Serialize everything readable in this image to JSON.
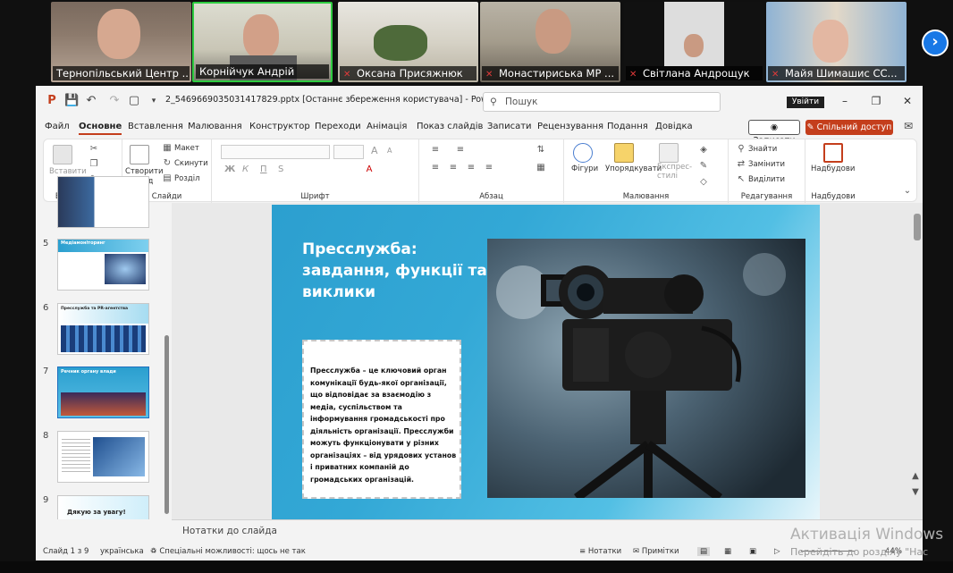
{
  "meeting": {
    "participants": [
      {
        "name": "Тернопільський Центр ...",
        "muted": false,
        "active": false
      },
      {
        "name": "Корнійчук Андрій",
        "muted": false,
        "active": true
      },
      {
        "name": "Оксана Присяжнюк",
        "muted": true,
        "active": false
      },
      {
        "name": "Монастириська МР ...",
        "muted": true,
        "active": false
      },
      {
        "name": "Світлана Андрощук",
        "muted": true,
        "active": false
      },
      {
        "name": "Майя Шимашис   СС...",
        "muted": true,
        "active": false
      }
    ],
    "next_icon": "chevron-right-icon"
  },
  "titlebar": {
    "doc_title": "2_5469669035031417829.pptx [Останнє збереження користувача]  -  PowerPoint Prev...",
    "search_placeholder": "Пошук",
    "signin_label": "Увійти"
  },
  "menu": {
    "items": [
      "Файл",
      "Основне",
      "Вставлення",
      "Малювання",
      "Конструктор",
      "Переходи",
      "Анімація",
      "Показ слайдів",
      "Записати",
      "Рецензування",
      "Подання",
      "Довідка"
    ],
    "active_index": 1,
    "record_label": "Записати",
    "share_label": "Спільний доступ"
  },
  "ribbon": {
    "clipboard": {
      "paste_label": "Вставити",
      "group_label": "Буфер обміну"
    },
    "slides": {
      "new_slide_label": "Створити слайд",
      "layout_label": "Макет",
      "reset_label": "Скинути",
      "section_label": "Розділ",
      "group_label": "Слайди"
    },
    "font": {
      "group_label": "Шрифт",
      "bold": "Ж",
      "italic": "К",
      "underline": "П",
      "strike": "S",
      "size_up": "A",
      "size_down": "A"
    },
    "paragraph": {
      "group_label": "Абзац"
    },
    "drawing": {
      "shapes_label": "Фігури",
      "arrange_label": "Упорядкувати",
      "styles_label": "Експрес-стилі",
      "group_label": "Малювання"
    },
    "editing": {
      "find_label": "Знайти",
      "replace_label": "Замінити",
      "select_label": "Виділити",
      "group_label": "Редагування"
    },
    "addins": {
      "addins_label": "Надбудови",
      "group_label": "Надбудови"
    }
  },
  "thumbnails": [
    {
      "number": "",
      "title": ""
    },
    {
      "number": "5",
      "title": "Медіамоніторинг"
    },
    {
      "number": "6",
      "title": "Пресслужба та PR-агентства"
    },
    {
      "number": "7",
      "title": "Речник органу влади"
    },
    {
      "number": "8",
      "title": ""
    },
    {
      "number": "9",
      "title": "Дякую за увагу!"
    }
  ],
  "slide": {
    "title": "Пресслужба: завдання, функції та виклики",
    "body": "Пресслужба – це ключовий орган комунікації будь-якої організації, що відповідає за взаємодію з медіа, суспільством та інформування громадськості про діяльність організації. Пресслужби можуть функціонувати у різних організаціях – від урядових установ і приватних компаній до громадських організацій."
  },
  "notes_placeholder": "Нотатки до слайда",
  "status": {
    "slide_count": "Слайд 1 з 9",
    "language": "українська",
    "accessibility": "Спеціальні можливості: щось не так",
    "notes_btn": "Нотатки",
    "comments_btn": "Примітки",
    "zoom": "44%"
  },
  "activation": {
    "title": "Активація Windows",
    "subtitle": "Перейдіть до розділу \"Нас"
  }
}
